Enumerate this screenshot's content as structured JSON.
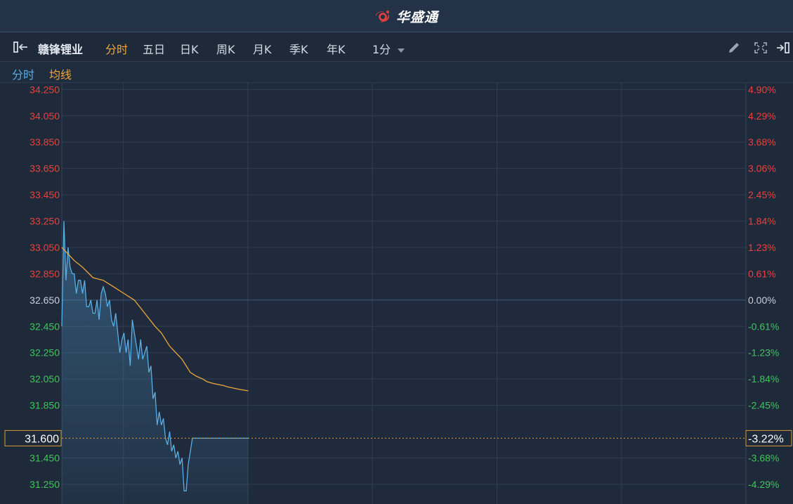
{
  "app": {
    "brand": "华盛通"
  },
  "toolbar": {
    "stock_name": "赣锋锂业",
    "tabs": [
      "分时",
      "五日",
      "日K",
      "周K",
      "月K",
      "季K",
      "年K"
    ],
    "active_tab": "分时",
    "interval": "1分"
  },
  "legend": {
    "price_label": "分时",
    "avg_label": "均线"
  },
  "colors": {
    "up": "#e8413e",
    "down": "#3ec55a",
    "neutral": "#c9d1dc",
    "price_line": "#59aee6",
    "avg_line": "#f0a63a",
    "grid": "#2f3e52",
    "background": "#1e2a3a"
  },
  "chart_data": {
    "type": "line",
    "prev_close": 32.65,
    "ylim": [
      31.1,
      34.3
    ],
    "left_ticks": [
      "34.250",
      "34.050",
      "33.850",
      "33.650",
      "33.450",
      "33.250",
      "33.050",
      "32.850",
      "32.650",
      "32.450",
      "32.250",
      "32.050",
      "31.850",
      "31.450",
      "31.250"
    ],
    "right_ticks": [
      "4.90%",
      "4.29%",
      "3.68%",
      "3.06%",
      "2.45%",
      "1.84%",
      "1.23%",
      "0.61%",
      "0.00%",
      "-0.61%",
      "-1.23%",
      "-1.84%",
      "-2.45%",
      "-3.68%",
      "-4.29%"
    ],
    "current": {
      "price": "31.600",
      "change": "-3.22%"
    },
    "session_minutes": 330,
    "series": [
      {
        "name": "分时",
        "x": [
          0,
          1,
          2,
          3,
          4,
          5,
          6,
          7,
          8,
          9,
          10,
          11,
          12,
          13,
          14,
          15,
          16,
          17,
          18,
          19,
          20,
          21,
          22,
          23,
          24,
          25,
          26,
          27,
          28,
          29,
          30,
          31,
          32,
          33,
          34,
          35,
          36,
          37,
          38,
          39,
          40,
          41,
          42,
          43,
          44,
          45,
          46,
          47,
          48,
          49,
          50,
          51,
          52,
          53,
          54,
          55,
          56,
          57,
          58,
          59,
          60,
          61,
          62,
          63,
          64,
          65,
          66,
          67,
          68,
          69,
          70,
          71,
          72,
          73,
          74,
          75,
          76,
          77,
          78,
          79,
          80,
          81,
          82,
          83,
          84,
          85,
          86,
          87,
          88,
          89,
          90
        ],
        "values": [
          32.45,
          33.25,
          32.8,
          33.05,
          32.9,
          32.85,
          32.85,
          32.7,
          32.8,
          32.8,
          32.7,
          32.8,
          32.6,
          32.6,
          32.65,
          32.55,
          32.55,
          32.65,
          32.5,
          32.7,
          32.75,
          32.7,
          32.6,
          32.65,
          32.5,
          32.45,
          32.55,
          32.4,
          32.25,
          32.35,
          32.4,
          32.25,
          32.35,
          32.15,
          32.5,
          32.4,
          32.3,
          32.2,
          32.35,
          32.2,
          32.25,
          32.3,
          32.1,
          32.15,
          31.9,
          31.95,
          31.7,
          31.8,
          31.7,
          31.75,
          31.6,
          31.55,
          31.65,
          31.5,
          31.55,
          31.45,
          31.5,
          31.4,
          31.45,
          31.2,
          31.2,
          31.4,
          31.5,
          31.6,
          31.6,
          31.6,
          31.6,
          31.6,
          31.6,
          31.6,
          31.6,
          31.6,
          31.6,
          31.6,
          31.6,
          31.6,
          31.6,
          31.6,
          31.6,
          31.6,
          31.6,
          31.6,
          31.6,
          31.6,
          31.6,
          31.6,
          31.6,
          31.6,
          31.6,
          31.6,
          31.6
        ]
      },
      {
        "name": "均线",
        "x": [
          0,
          3,
          6,
          10,
          15,
          20,
          25,
          30,
          35,
          40,
          45,
          48,
          52,
          55,
          58,
          60,
          62,
          65,
          68,
          70,
          72,
          75,
          78,
          80,
          83,
          86,
          90
        ],
        "values": [
          33.05,
          33.0,
          32.95,
          32.9,
          32.82,
          32.8,
          32.75,
          32.7,
          32.65,
          32.55,
          32.45,
          32.4,
          32.3,
          32.25,
          32.2,
          32.15,
          32.1,
          32.07,
          32.05,
          32.03,
          32.02,
          32.01,
          32.0,
          31.99,
          31.98,
          31.97,
          31.96
        ]
      }
    ]
  }
}
